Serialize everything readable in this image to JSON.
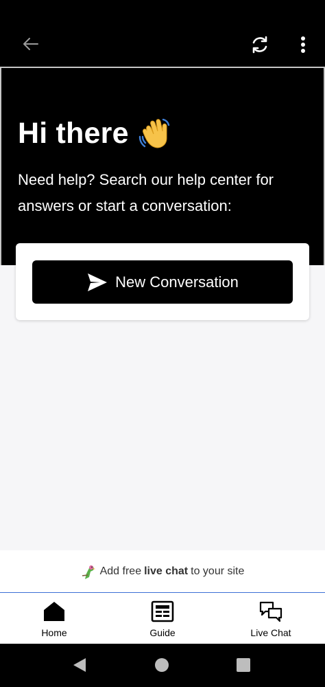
{
  "header": {
    "back_icon": "arrow-left-icon",
    "refresh_icon": "refresh-icon",
    "more_icon": "more-vertical-icon"
  },
  "hero": {
    "title": "Hi there",
    "wave_icon": "waving-hand-icon",
    "subtitle": "Need help? Search our help center for answers or start a conversation:"
  },
  "card": {
    "button_label": "New Conversation",
    "button_icon": "send-icon"
  },
  "promo": {
    "prefix": "Add free",
    "bold": "live chat",
    "suffix": "to your site",
    "icon": "parrot-icon"
  },
  "tabs": [
    {
      "label": "Home",
      "icon": "home-icon"
    },
    {
      "label": "Guide",
      "icon": "guide-icon"
    },
    {
      "label": "Live Chat",
      "icon": "chat-bubbles-icon"
    }
  ],
  "colors": {
    "header_bg": "#000000",
    "body_bg": "#f6f6f8",
    "button_bg": "#000000",
    "promo_divider": "#3b6fd6"
  }
}
